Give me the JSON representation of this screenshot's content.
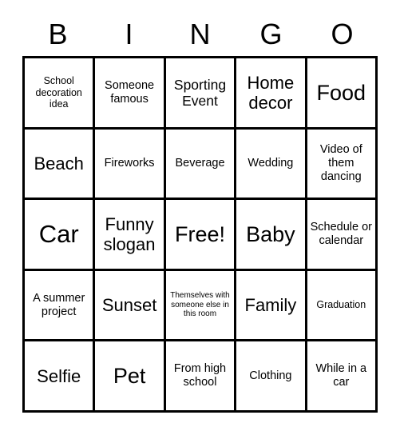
{
  "card": {
    "title": "BINGO Card",
    "header_letters": [
      "B",
      "I",
      "N",
      "G",
      "O"
    ],
    "colors": {
      "background": "#ffffff",
      "text": "#000000",
      "border": "#000000"
    },
    "grid": {
      "columns": 5,
      "rows": 5,
      "free_space": "Free!"
    },
    "cells": [
      {
        "text": "School decoration idea",
        "size": "sm"
      },
      {
        "text": "Someone famous",
        "size": "md"
      },
      {
        "text": "Sporting Event",
        "size": "lg"
      },
      {
        "text": "Home decor",
        "size": "xl"
      },
      {
        "text": "Food",
        "size": "xxl"
      },
      {
        "text": "Beach",
        "size": "xl"
      },
      {
        "text": "Fireworks",
        "size": "md"
      },
      {
        "text": "Beverage",
        "size": "md"
      },
      {
        "text": "Wedding",
        "size": "md"
      },
      {
        "text": "Video of them dancing",
        "size": "md"
      },
      {
        "text": "Car",
        "size": "huge"
      },
      {
        "text": "Funny slogan",
        "size": "xl"
      },
      {
        "text": "Free!",
        "size": "xxl"
      },
      {
        "text": "Baby",
        "size": "xxl"
      },
      {
        "text": "Schedule or calendar",
        "size": "md"
      },
      {
        "text": "A summer project",
        "size": "md"
      },
      {
        "text": "Sunset",
        "size": "xl"
      },
      {
        "text": "Themselves with someone else in this room",
        "size": "xs"
      },
      {
        "text": "Family",
        "size": "xl"
      },
      {
        "text": "Graduation",
        "size": "sm"
      },
      {
        "text": "Selfie",
        "size": "xl"
      },
      {
        "text": "Pet",
        "size": "xxl"
      },
      {
        "text": "From high school",
        "size": "md"
      },
      {
        "text": "Clothing",
        "size": "md"
      },
      {
        "text": "While in a car",
        "size": "md"
      }
    ]
  }
}
